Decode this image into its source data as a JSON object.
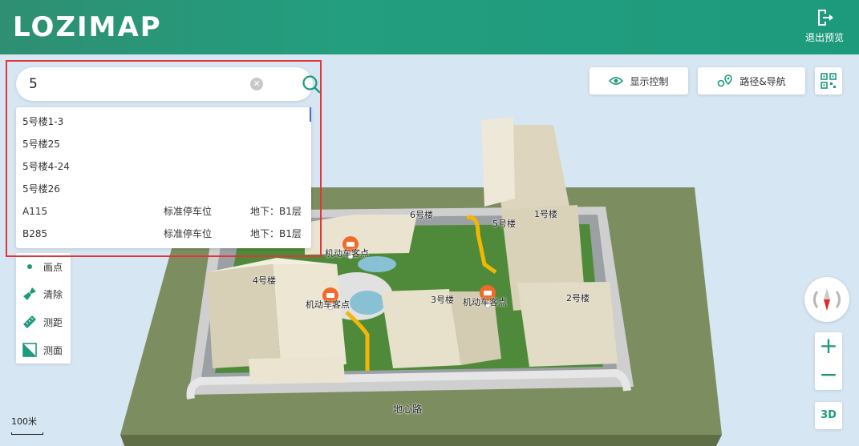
{
  "header": {
    "logo_text": "LOZIMAP",
    "exit_label": "退出预览"
  },
  "toolbar": {
    "display_control": "显示控制",
    "route_nav": "路径&导航"
  },
  "search": {
    "value": "5",
    "results": [
      {
        "name": "5号楼1-3",
        "type": "",
        "floor": ""
      },
      {
        "name": "5号楼25",
        "type": "",
        "floor": ""
      },
      {
        "name": "5号楼4-24",
        "type": "",
        "floor": ""
      },
      {
        "name": "5号楼26",
        "type": "",
        "floor": ""
      },
      {
        "name": "A115",
        "type": "标准停车位",
        "floor": "地下：B1层"
      },
      {
        "name": "B285",
        "type": "标准停车位",
        "floor": "地下：B1层"
      }
    ]
  },
  "tools": [
    {
      "label": "画点",
      "icon": "point-icon"
    },
    {
      "label": "清除",
      "icon": "broom-icon"
    },
    {
      "label": "测距",
      "icon": "ruler-icon"
    },
    {
      "label": "测面",
      "icon": "area-icon"
    }
  ],
  "map": {
    "labels": {
      "b6": "6号楼",
      "b5": "5号楼",
      "b4": "4号楼",
      "b3": "3号楼",
      "b2": "2号楼",
      "b1": "1号楼",
      "road": "地心路",
      "poi1": "机动车客点",
      "poi2": "机动车客点",
      "poi3": "机动车客点"
    },
    "scale_label": "100米",
    "mode_3d": "3D"
  },
  "colors": {
    "brand": "#1d9a7c",
    "highlight": "#e2353a",
    "pin": "#f06a2a",
    "route": "#f2b705"
  }
}
